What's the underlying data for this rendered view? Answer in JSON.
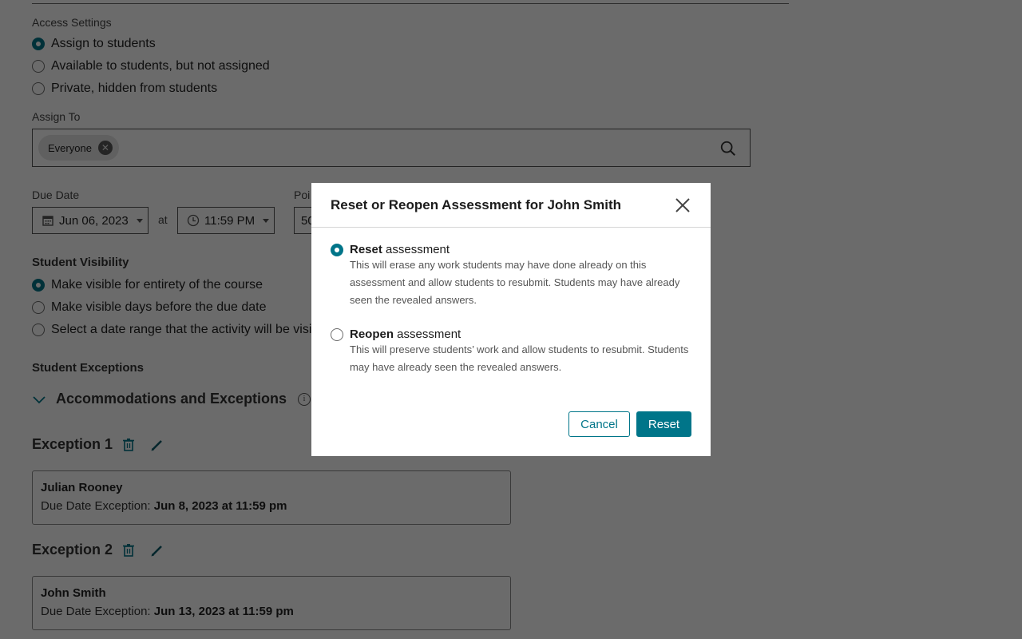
{
  "background_page": {
    "access_settings": {
      "label": "Access Settings",
      "options": [
        {
          "label": "Assign to students",
          "selected": true
        },
        {
          "label": "Available to students, but not assigned",
          "selected": false
        },
        {
          "label": "Private, hidden from students",
          "selected": false
        }
      ]
    },
    "assign_to": {
      "label": "Assign To",
      "chips": [
        {
          "label": "Everyone",
          "remove_icon": "close-circle-icon"
        }
      ],
      "search_icon": "search-icon"
    },
    "due_date": {
      "label": "Due Date",
      "date_value": "Jun 06, 2023",
      "at_label": "at",
      "time_value": "11:59 PM",
      "calendar_icon": "calendar-icon",
      "clock_icon": "clock-icon"
    },
    "points": {
      "label": "Poi",
      "value": "50"
    },
    "student_visibility": {
      "label": "Student Visibility",
      "options": [
        {
          "label": "Make visible for entirety of the course",
          "selected": true
        },
        {
          "label": "Make visible days before the due date",
          "selected": false
        },
        {
          "label": "Select a date range that the activity will be visible",
          "selected": false
        }
      ]
    },
    "student_exceptions": {
      "label": "Student Exceptions",
      "accordion_title": "Accommodations and Exceptions",
      "exceptions": [
        {
          "title": "Exception 1",
          "student": "Julian Rooney",
          "due_label": "Due Date Exception:",
          "due_value": "Jun 8, 2023 at 11:59 pm"
        },
        {
          "title": "Exception 2",
          "student": "John Smith",
          "due_label": "Due Date Exception:",
          "due_value": "Jun 13, 2023 at 11:59 pm"
        }
      ]
    }
  },
  "modal": {
    "title": "Reset or Reopen Assessment for John Smith",
    "close_icon": "close-icon",
    "options": [
      {
        "bold": "Reset",
        "rest": " assessment",
        "selected": true,
        "description": "This will erase any work students may have done already on this assessment and allow students to resubmit. Students may have already seen the revealed answers."
      },
      {
        "bold": "Reopen",
        "rest": " assessment",
        "selected": false,
        "description": "This will preserve students’ work and allow students to resubmit. Students may have already seen the revealed answers."
      }
    ],
    "cancel_label": "Cancel",
    "confirm_label": "Reset"
  },
  "colors": {
    "accent": "#007589",
    "overlay": "rgba(0,0,0,0.58)"
  }
}
